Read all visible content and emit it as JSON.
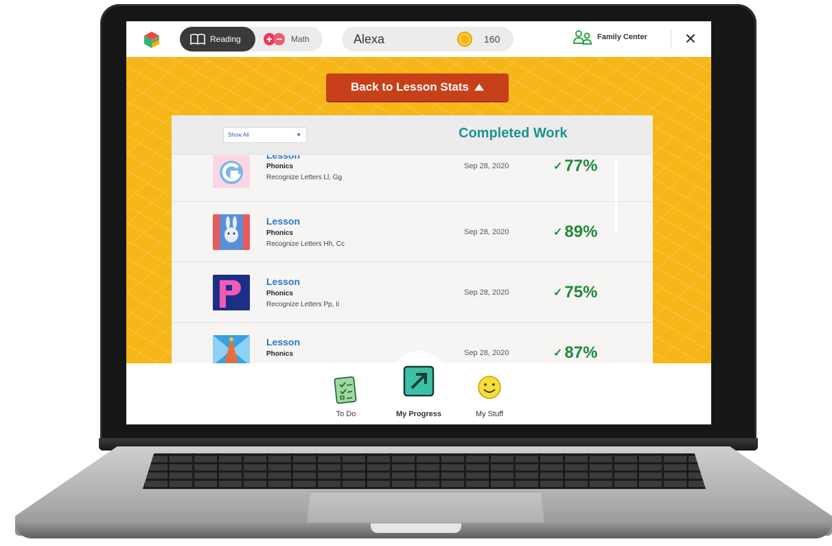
{
  "topbar": {
    "subjects": [
      {
        "label": "Reading",
        "active": true
      },
      {
        "label": "Math",
        "active": false
      }
    ],
    "user_name": "Alexa",
    "coins": "160",
    "family_center": "Family Center"
  },
  "back_button": {
    "label": "Back to Lesson Stats"
  },
  "panel": {
    "filter_value": "Show All",
    "title": "Completed Work"
  },
  "rows": [
    {
      "type": "Lesson",
      "category": "Phonics",
      "description": "Recognize Letters Ll, Gg",
      "date": "Sep 28, 2020",
      "score": "77%"
    },
    {
      "type": "Lesson",
      "category": "Phonics",
      "description": "Recognize Letters Hh, Cc",
      "date": "Sep 28, 2020",
      "score": "89%"
    },
    {
      "type": "Lesson",
      "category": "Phonics",
      "description": "Recognize Letters Pp, Ii",
      "date": "Sep 28, 2020",
      "score": "75%"
    },
    {
      "type": "Lesson",
      "category": "Phonics",
      "description": "",
      "date": "Sep 28, 2020",
      "score": "87%"
    }
  ],
  "bottom_nav": [
    {
      "label": "To Do",
      "active": false
    },
    {
      "label": "My Progress",
      "active": true
    },
    {
      "label": "My Stuff",
      "active": false
    }
  ],
  "colors": {
    "accent_yellow": "#f6b617",
    "back_button": "#c8401a",
    "title_teal": "#19948f",
    "lesson_blue": "#2876c9",
    "score_green": "#1f8a3a"
  }
}
